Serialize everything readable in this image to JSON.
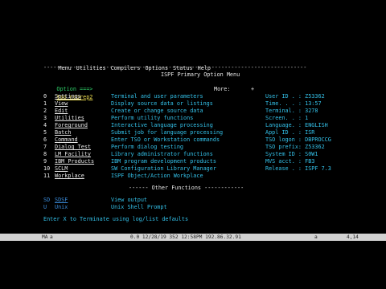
{
  "menubar": [
    "Menu",
    "Utilities",
    "Compilers",
    "Options",
    "Status",
    "Help"
  ],
  "header": {
    "rule": "--------------------------------------------------------------------------------",
    "title": "ISPF Primary Option Menu"
  },
  "option_prompt": "Option ===>",
  "option_value": "tso ncorep2",
  "more_label": "More:",
  "more_indicator": "+",
  "options": [
    {
      "key": "0",
      "name": "Settings",
      "desc": "Terminal and user parameters"
    },
    {
      "key": "1",
      "name": "View",
      "desc": "Display source data or listings"
    },
    {
      "key": "2",
      "name": "Edit",
      "desc": "Create or change source data"
    },
    {
      "key": "3",
      "name": "Utilities",
      "desc": "Perform utility functions"
    },
    {
      "key": "4",
      "name": "Foreground",
      "desc": "Interactive language processing"
    },
    {
      "key": "5",
      "name": "Batch",
      "desc": "Submit job for language processing"
    },
    {
      "key": "6",
      "name": "Command",
      "desc": "Enter TSO or Workstation commands"
    },
    {
      "key": "7",
      "name": "Dialog Test",
      "desc": "Perform dialog testing"
    },
    {
      "key": "9",
      "name": "IBM Products",
      "desc": "IBM program development products"
    },
    {
      "key": "10",
      "name": "SCLM",
      "desc": "SW Configuration Library Manager"
    },
    {
      "key": "11",
      "name": "Workplace",
      "desc": "ISPF Object/Action Workplace"
    }
  ],
  "lm_option": {
    "key": "8",
    "name": "LM Facility",
    "desc": "Library administrator functions"
  },
  "session_info": [
    {
      "label": "User ID . :",
      "value": "Z53362"
    },
    {
      "label": "Time. . . :",
      "value": "13:57"
    },
    {
      "label": "Terminal. :",
      "value": "3278"
    },
    {
      "label": "Screen. . :",
      "value": "1"
    },
    {
      "label": "Language. :",
      "value": "ENGLISH"
    },
    {
      "label": "Appl ID . :",
      "value": "ISR"
    },
    {
      "label": "TSO logon :",
      "value": "DBPROCCG"
    },
    {
      "label": "TSO prefix:",
      "value": "Z53362"
    },
    {
      "label": "System ID :",
      "value": "S0W1"
    },
    {
      "label": "MVS acct. :",
      "value": "FB3"
    },
    {
      "label": "Release . :",
      "value": "ISPF 7.3"
    }
  ],
  "other_functions_heading": "------ Other Functions ------------",
  "other_functions": [
    {
      "key": "SD",
      "name": "SDSF",
      "desc": "View output"
    },
    {
      "key": "U",
      "name": "Unix",
      "desc": "Unix Shell Prompt"
    }
  ],
  "footer_hint": "Enter X to Terminate using log/list defaults",
  "status": {
    "left": "MA",
    "marker": "a",
    "session": "0.0 12/28/19 352 12:58PM 192.86.32.91",
    "mode": "a",
    "cursor": "4,14"
  }
}
